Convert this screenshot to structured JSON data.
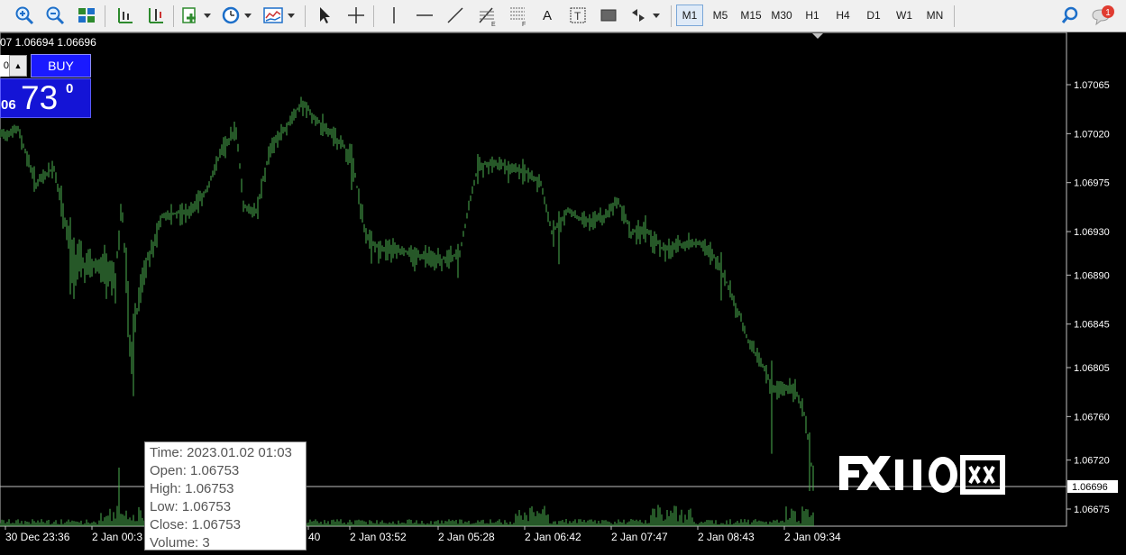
{
  "toolbar": {
    "icons": [
      "zoom-in-icon",
      "zoom-out-icon",
      "tile-windows-icon",
      "autoscroll-icon",
      "chart-shift-icon",
      "new-order-icon",
      "history-clock-icon",
      "indicators-icon",
      "cursor-icon",
      "crosshair-icon",
      "vertical-line-icon",
      "horizontal-line-icon",
      "trendline-icon",
      "fibonacci-icon",
      "fibonacci-fan-icon",
      "text-icon",
      "text-label-icon",
      "rectangle-icon",
      "arrows-icon"
    ],
    "text_tool": "A",
    "timeframes": [
      "M1",
      "M5",
      "M15",
      "M30",
      "H1",
      "H4",
      "D1",
      "W1",
      "MN"
    ],
    "active_timeframe": "M1",
    "notification_count": "1"
  },
  "chart": {
    "ohlc_header": "07 1.06694 1.06696",
    "background": "#000000",
    "bar_color": "#4caf50",
    "price_labels": [
      "1.07065",
      "1.07020",
      "1.06975",
      "1.06930",
      "1.06890",
      "1.06845",
      "1.06805",
      "1.06760",
      "1.06720",
      "1.06675"
    ],
    "current_price": "1.06696",
    "time_labels": [
      "30 Dec 23:36",
      "2 Jan 00:3",
      "40",
      "2 Jan 03:52",
      "2 Jan 05:28",
      "2 Jan 06:42",
      "2 Jan 07:47",
      "2 Jan 08:43",
      "2 Jan 09:34"
    ]
  },
  "trade_panel": {
    "qty": "0",
    "up_arrow": "▲",
    "buy_label": "BUY",
    "price_small": "06",
    "price_big": "73",
    "price_sup": "0"
  },
  "tooltip": {
    "time": "Time: 2023.01.02 01:03",
    "open": "Open: 1.06753",
    "high": "High: 1.06753",
    "low": "Low:  1.06753",
    "close": "Close: 1.06753",
    "volume": "Volume: 3"
  },
  "watermark": {
    "text": "FX110网"
  }
}
